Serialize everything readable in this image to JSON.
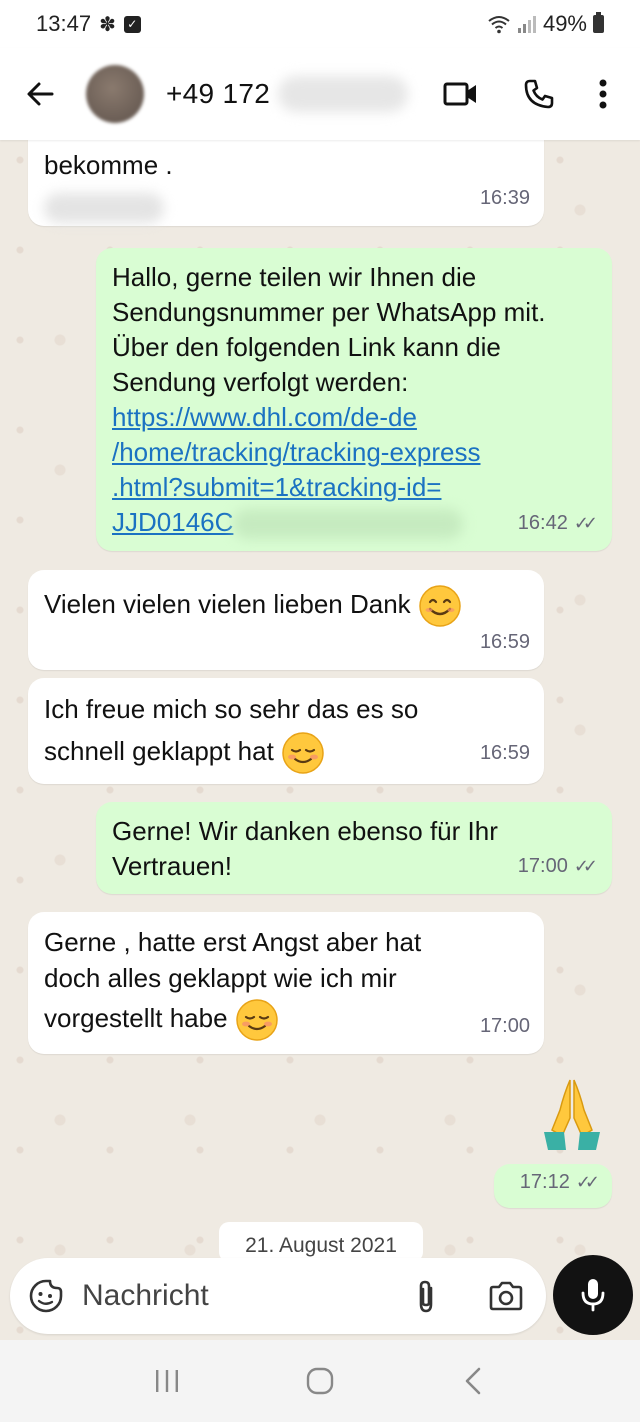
{
  "status_bar": {
    "time": "13:47",
    "battery": "49%",
    "icons": [
      "flower-notification-icon",
      "checkbox-notification-icon",
      "wifi-icon",
      "signal-icon",
      "battery-icon"
    ]
  },
  "header": {
    "contact_number": "+49 172",
    "icons": [
      "back-arrow-icon",
      "avatar",
      "video-call-icon",
      "phone-call-icon",
      "more-options-icon"
    ]
  },
  "messages": [
    {
      "direction": "in",
      "text": "bekomme .",
      "time": "16:39"
    },
    {
      "direction": "out",
      "text": "Hallo, gerne teilen wir Ihnen die Sendungsnummer per WhatsApp mit. Über den folgenden Link kann die Sendung verfolgt werden:",
      "link_lines": [
        "https://www.dhl.com/de-de",
        "/home/tracking/tracking-express",
        ".html?submit=1&tracking-id=",
        "JJD0146C"
      ],
      "time": "16:42",
      "ticks": "✓✓"
    },
    {
      "direction": "in",
      "text": "Vielen vielen vielen lieben Dank",
      "emoji": "smiling-face-icon",
      "time": "16:59"
    },
    {
      "direction": "in",
      "text": "Ich freue mich so sehr das es so schnell geklappt hat",
      "emoji": "blushing-face-icon",
      "time": "16:59"
    },
    {
      "direction": "out",
      "text": "Gerne! Wir danken ebenso für Ihr Vertrauen!",
      "time": "17:00",
      "ticks": "✓✓"
    },
    {
      "direction": "in",
      "text": "Gerne , hatte erst Angst aber hat doch alles geklappt wie ich mir vorgestellt habe",
      "emoji": "blushing-face-icon",
      "time": "17:00"
    },
    {
      "direction": "out",
      "emoji": "folded-hands-icon",
      "time": "17:12",
      "ticks": "✓✓"
    }
  ],
  "date_chip": "21. August 2021",
  "input": {
    "placeholder": "Nachricht",
    "icons": [
      "emoji-sticker-icon",
      "paperclip-icon",
      "camera-icon",
      "microphone-icon"
    ]
  },
  "nav_bar": {
    "icons": [
      "recent-apps-icon",
      "home-icon",
      "back-icon"
    ]
  },
  "colors": {
    "outgoing_bubble": "#d9fdd3",
    "incoming_bubble": "#ffffff",
    "chat_background": "#efeae2",
    "link": "#1b72c2",
    "mic_button": "#121212"
  }
}
